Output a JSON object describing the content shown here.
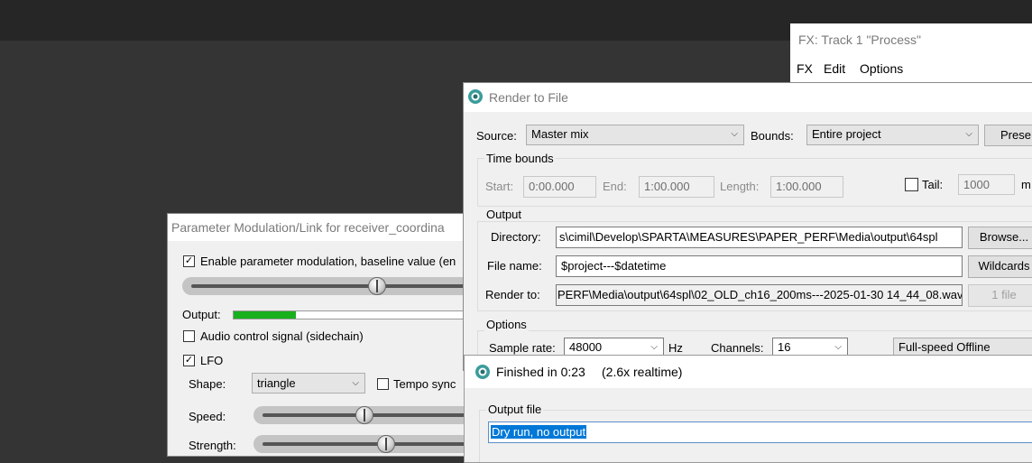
{
  "fx_window": {
    "title": "FX: Track 1 \"Process\"",
    "menu": [
      "FX",
      "Edit",
      "Options"
    ]
  },
  "param_mod_window": {
    "title": "Parameter Modulation/Link for receiver_coordina",
    "enable_label": "Enable parameter modulation, baseline value (en",
    "enable_checked": true,
    "baseline_level": 0.73,
    "output_label": "Output:",
    "output_level": 0.23,
    "audio_control_label": "Audio control signal (sidechain)",
    "audio_control_checked": false,
    "lfo_label": "LFO",
    "lfo_checked": true,
    "shape_label": "Shape:",
    "shape_value": "triangle",
    "tempo_sync_label": "Tempo sync",
    "tempo_sync_checked": false,
    "speed_label": "Speed:",
    "speed_level": 0.52,
    "strength_label": "Strength:",
    "strength_level": 0.62
  },
  "render_window": {
    "title": "Render to File",
    "source_label": "Source:",
    "source_value": "Master mix",
    "bounds_label": "Bounds:",
    "bounds_value": "Entire project",
    "presets_label": "Prese",
    "time_bounds_label": "Time bounds",
    "start_label": "Start:",
    "start_value": "0:00.000",
    "end_label": "End:",
    "end_value": "1:00.000",
    "length_label": "Length:",
    "length_value": "1:00.000",
    "tail_label": "Tail:",
    "tail_checked": false,
    "tail_value": "1000",
    "tail_unit": "m",
    "output_label": "Output",
    "directory_label": "Directory:",
    "directory_value": "s\\cimil\\Develop\\SPARTA\\MEASURES\\PAPER_PERF\\Media\\output\\64spl",
    "browse_label": "Browse...",
    "filename_label": "File name:",
    "filename_value": "$project---$datetime",
    "wildcards_label": "Wildcards",
    "render_to_label": "Render to:",
    "render_to_value": "PERF\\Media\\output\\64spl\\02_OLD_ch16_200ms---2025-01-30 14_44_08.wav",
    "files_label": "1 file",
    "options_label": "Options",
    "sample_rate_label": "Sample rate:",
    "sample_rate_value": "48000",
    "hz_label": "Hz",
    "channels_label": "Channels:",
    "channels_value": "16",
    "mode_value": "Full-speed Offline"
  },
  "finished_window": {
    "title": "Finished in 0:23",
    "realtime": "(2.6x realtime)",
    "output_file_label": "Output file",
    "output_file_value": "Dry run, no output"
  }
}
